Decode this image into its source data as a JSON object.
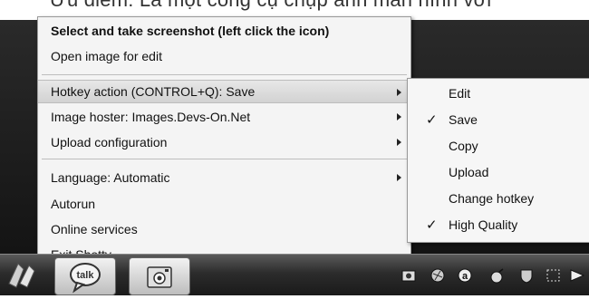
{
  "background_text": "Ưu điểm: Là một công cụ chụp ảnh màn hình với",
  "main_menu": {
    "items": [
      {
        "label": "Select and take screenshot (left click the icon)"
      },
      {
        "label": "Open image for edit"
      },
      {
        "label": "Hotkey action (CONTROL+Q): Save"
      },
      {
        "label": "Image hoster: Images.Devs-On.Net"
      },
      {
        "label": "Upload configuration"
      },
      {
        "label": "Language: Automatic"
      },
      {
        "label": "Autorun"
      },
      {
        "label": "Online services"
      },
      {
        "label": "Exit Shotty"
      }
    ]
  },
  "submenu": {
    "items": [
      {
        "label": "Edit",
        "checked": false
      },
      {
        "label": "Save",
        "checked": true
      },
      {
        "label": "Copy",
        "checked": false
      },
      {
        "label": "Upload",
        "checked": false
      },
      {
        "label": "Change hotkey",
        "checked": false
      },
      {
        "label": "High Quality",
        "checked": true
      }
    ],
    "check_mark": "✓"
  },
  "taskbar": {
    "talk_label": "talk"
  }
}
